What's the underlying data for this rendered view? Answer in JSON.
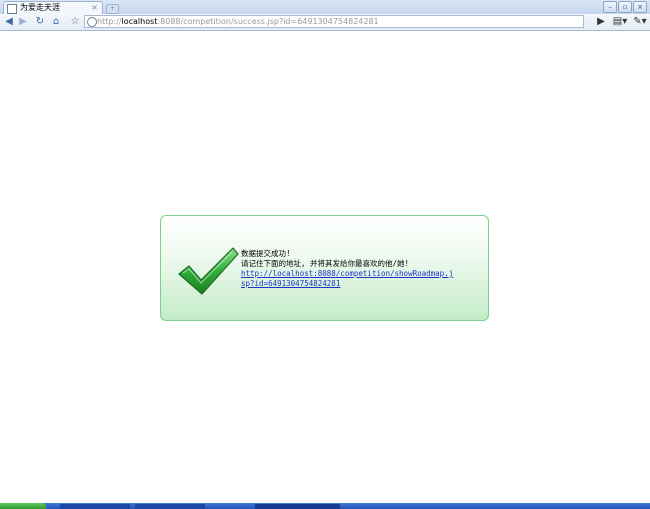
{
  "browser": {
    "tab_title": "为爱走天涯",
    "tab_close": "×",
    "url_scheme": "http://",
    "url_host": "localhost",
    "url_rest": ":8088/competition/success.jsp?id=6491304754824281",
    "icons": [
      "back-icon",
      "forward-icon",
      "reload-icon",
      "home-icon",
      "star-icon",
      "go-icon",
      "page-menu-icon",
      "wrench-icon"
    ]
  },
  "window_controls": [
    "minimize",
    "restore",
    "close"
  ],
  "success": {
    "line1": "数据提交成功!",
    "line2": "请记住下面的地址, 并将其发给你最喜欢的他/她!",
    "link": "http://localhost:8088/competition/showRoadmap.jsp?id=6491304754824281"
  },
  "colors": {
    "panel_border": "#7fcf88",
    "panel_gradient_bottom": "#c4ecc8",
    "checkmark": "#2fae38",
    "link": "#1a35c7"
  }
}
